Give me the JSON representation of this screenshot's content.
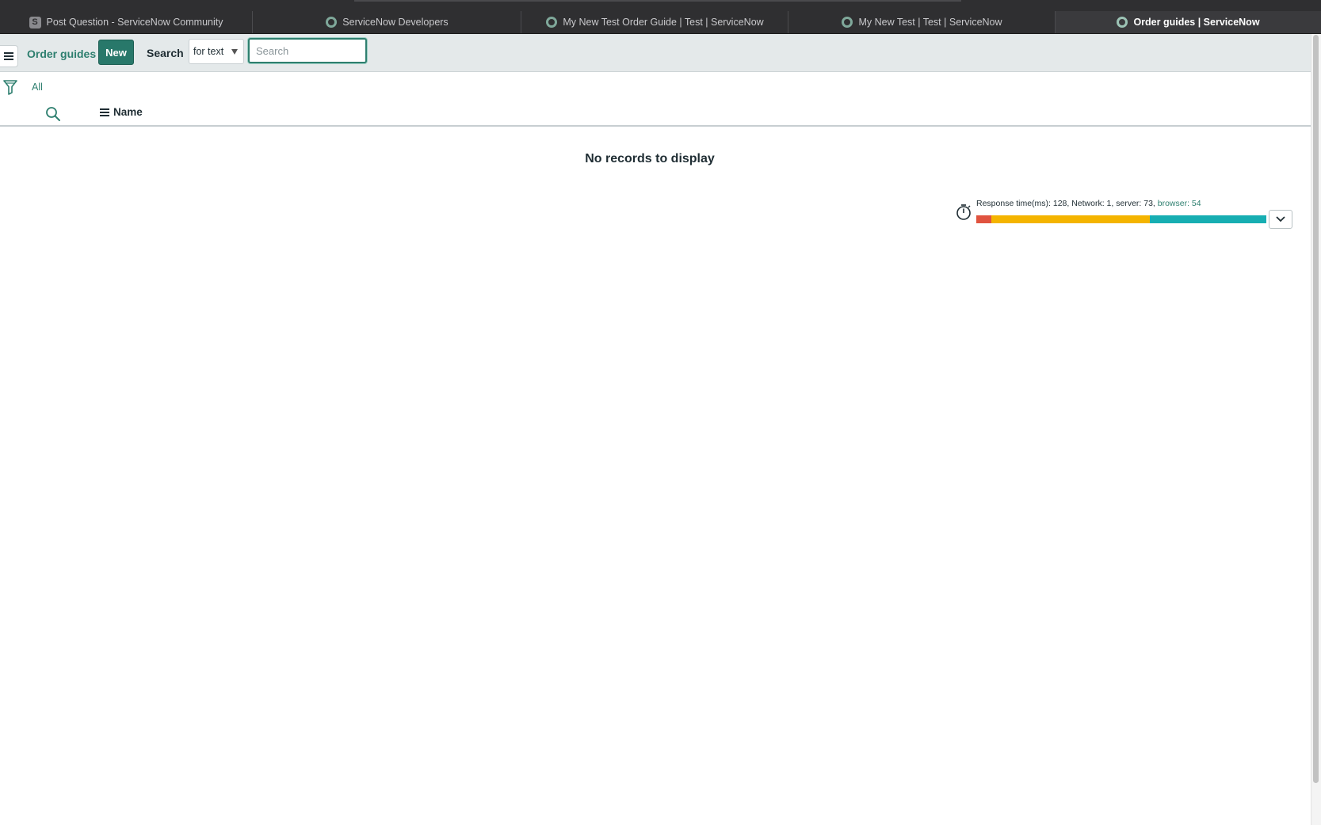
{
  "browser": {
    "tabs": [
      {
        "title": "Post Question - ServiceNow Community",
        "icon": "servicenow-s-favicon-icon",
        "badge": "S"
      },
      {
        "title": "ServiceNow Developers",
        "icon": "servicenow-favicon-icon"
      },
      {
        "title": "My New Test Order Guide | Test | ServiceNow",
        "icon": "servicenow-favicon-icon"
      },
      {
        "title": "My New Test | Test | ServiceNow",
        "icon": "servicenow-favicon-icon"
      },
      {
        "title": "Order guides | ServiceNow",
        "icon": "servicenow-favicon-icon",
        "active": true
      }
    ]
  },
  "list": {
    "title": "Order guides",
    "new_label": "New",
    "search_label": "Search",
    "search_field_select": "for text",
    "search_placeholder": "Search"
  },
  "filter": {
    "breadcrumb": "All"
  },
  "columns": [
    {
      "label": "Name"
    }
  ],
  "empty_message": "No records to display",
  "response_time": {
    "text": "Response time(ms): 128, Network: 1, server: 73, ",
    "browser_link": "browser: 54",
    "network_ms": 1,
    "server_ms": 73,
    "browser_ms": 54,
    "total_ms": 128,
    "colors": {
      "network": "#e0533f",
      "server": "#f4b400",
      "browser": "#17aeb2"
    }
  },
  "colors": {
    "accent": "#2e7f6f",
    "new_button": "#28786a",
    "tabstrip": "#2f2f31"
  }
}
